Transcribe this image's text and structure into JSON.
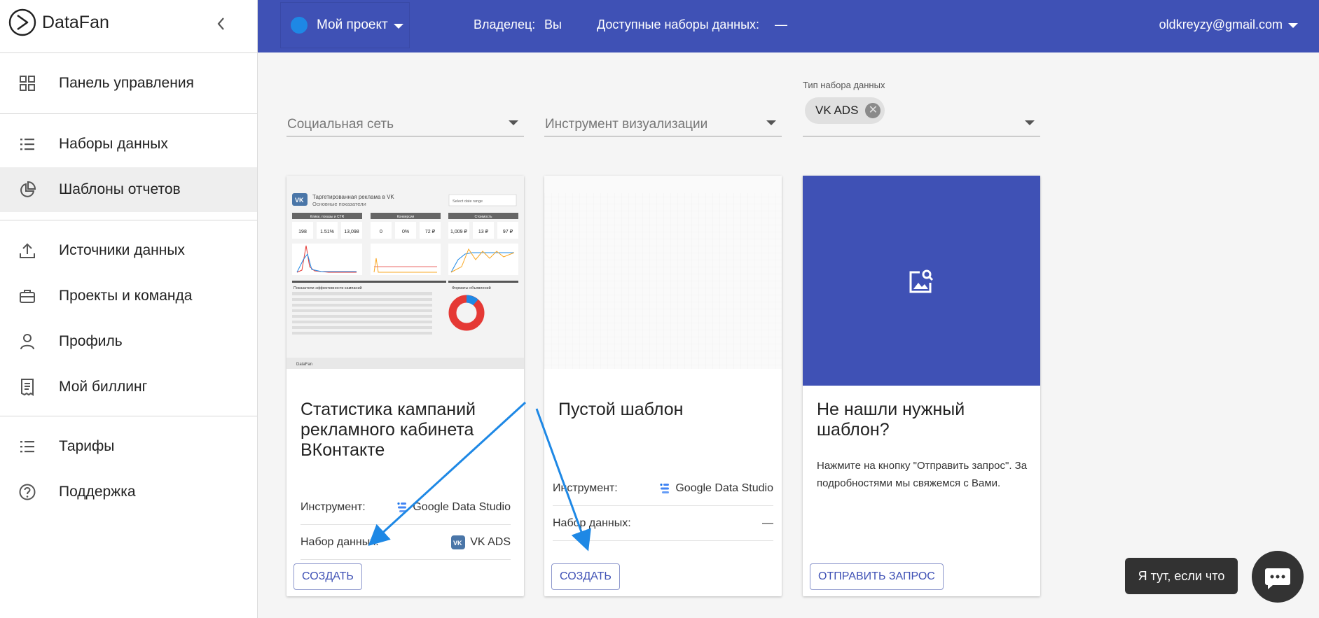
{
  "app": {
    "name": "DataFan"
  },
  "sidebar": {
    "items": [
      {
        "label": "Панель управления",
        "icon": "dashboard-grid-icon"
      },
      {
        "label": "Наборы данных",
        "icon": "list-icon"
      },
      {
        "label": "Шаблоны отчетов",
        "icon": "pie-chart-icon"
      },
      {
        "label": "Источники данных",
        "icon": "upload-icon"
      },
      {
        "label": "Проекты и команда",
        "icon": "briefcase-icon"
      },
      {
        "label": "Профиль",
        "icon": "person-icon"
      },
      {
        "label": "Мой биллинг",
        "icon": "receipt-icon"
      },
      {
        "label": "Тарифы",
        "icon": "list-icon"
      },
      {
        "label": "Поддержка",
        "icon": "help-circle-icon"
      }
    ]
  },
  "topbar": {
    "project": "Мой проект",
    "owner_label": "Владелец:",
    "owner_value": "Вы",
    "datasets_label": "Доступные наборы данных:",
    "datasets_value": "—",
    "user_email": "oldkreyzy@gmail.com"
  },
  "filters": {
    "social": {
      "placeholder": "Социальная сеть"
    },
    "viz": {
      "placeholder": "Инструмент визуализации"
    },
    "dataset_type": {
      "label": "Тип набора данных",
      "chip": "VK ADS"
    }
  },
  "cards": [
    {
      "title": "Статистика кампаний рекламного кабинета ВКонтакте",
      "tool_label": "Инструмент:",
      "tool_value": "Google Data Studio",
      "dataset_label": "Набор данных:",
      "dataset_value": "VK ADS",
      "button": "Создать",
      "preview": {
        "heading": "Таргетированная реклама в VK",
        "subheading": "Основные показатели",
        "select": "Select date range",
        "sections": [
          "Клики, показы и CTR",
          "Конверсии",
          "Стоимость"
        ],
        "kpis": [
          "198",
          "1.51%",
          "13,098",
          "0",
          "0%",
          "72 ₽",
          "1,009 ₽",
          "13 ₽",
          "97 ₽"
        ],
        "table_title": "Показатели эффективности кампаний",
        "donut_title": "Форматы объявлений",
        "footer": "DataFan"
      }
    },
    {
      "title": "Пустой шаблон",
      "tool_label": "Инструмент:",
      "tool_value": "Google Data Studio",
      "dataset_label": "Набор данных:",
      "dataset_value": "—",
      "button": "Создать"
    },
    {
      "title": "Не нашли нужный шаблон?",
      "text": "Нажмите на кнопку \"Отправить запрос\". За подробностями мы свяжемся с Вами.",
      "button": "Отправить запрос",
      "banner_color": "#3f51b5",
      "icon": "image-search-icon"
    }
  ],
  "chat": {
    "tooltip": "Я тут, если что"
  },
  "colors": {
    "primary": "#3f51b5",
    "annotation_arrow": "#1e88e5"
  }
}
